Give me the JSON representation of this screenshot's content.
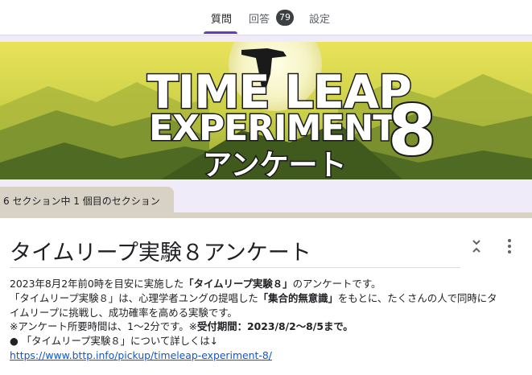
{
  "tabs": [
    {
      "label": "質問",
      "active": true
    },
    {
      "label": "回答",
      "count": "79"
    },
    {
      "label": "設定"
    }
  ],
  "banner": {
    "line1": "TIME LEAP",
    "line2": "EXPERIMENT",
    "number": "8",
    "subtitle": "アンケート"
  },
  "section": {
    "label": "6 セクション中 1 個目のセクション"
  },
  "form": {
    "title": "タイムリープ実験８アンケート",
    "description": {
      "l1_a": "2023年8月2年前0時を目安に実施した",
      "l1_b": "「タイムリープ実験８」",
      "l1_c": "のアンケートです。",
      "l2_a": "「タイムリープ実験８」は、心理学者ユングの提唱した",
      "l2_b": "「集合的無意識」",
      "l2_c": "をもとに、たくさんの人で同時にタ",
      "l3": "イムリープに挑戦し、成功確率を高める実験です。",
      "l4_a": "※アンケート所要時間は、1〜2分です。※",
      "l4_b": "受付期間：2023/8/2〜8/5まで。",
      "l5": "● 「タイムリープ実験８」について詳しくは↓",
      "link": "https://www.bttp.info/pickup/timeleap-experiment-8/"
    }
  },
  "icons": {
    "collapse": "collapse-chevrons-icon",
    "more": "more-vertical-icon"
  },
  "colors": {
    "accent": "#673ab7",
    "badge": "#3c4043",
    "link": "#1155cc",
    "section_band": "#d7d2c5",
    "background": "#f0ebf8"
  }
}
